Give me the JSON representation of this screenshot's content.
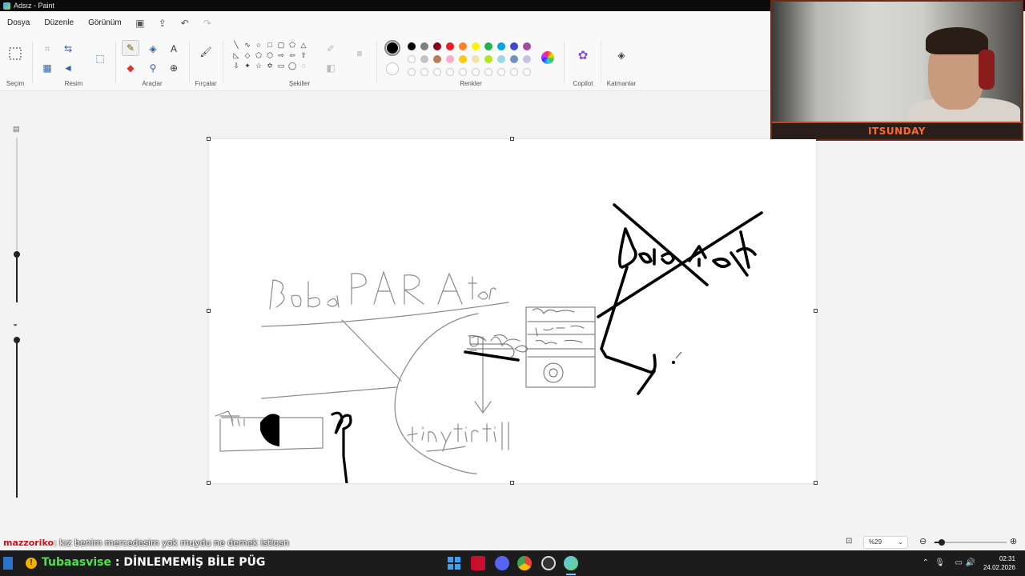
{
  "window": {
    "title": "Adsız - Paint"
  },
  "menu": {
    "items": [
      "Dosya",
      "Düzenle",
      "Görünüm"
    ]
  },
  "ribbon": {
    "groups": {
      "selection": "Seçim",
      "image": "Resim",
      "tools": "Araçlar",
      "brushes": "Fırçalar",
      "shapes": "Şekiller",
      "colors": "Renkler",
      "copilot": "Copilot",
      "layers": "Katmanlar"
    },
    "active_tool": "pencil",
    "primary_color": "#000000",
    "secondary_color": "#ffffff",
    "palette_row1": [
      "#000000",
      "#7f7f7f",
      "#880015",
      "#ed1c24",
      "#ff7f27",
      "#fff200",
      "#22b14c",
      "#00a2e8",
      "#3f48cc",
      "#a349a4"
    ],
    "palette_row2": [
      "#ffffff",
      "#c3c3c3",
      "#b97a57",
      "#ffaec9",
      "#ffc90e",
      "#efe4b0",
      "#b5e61d",
      "#99d9ea",
      "#7092be",
      "#c8bfe7"
    ],
    "palette_row3": [
      "",
      "",
      "",
      "",
      "",
      "",
      "",
      "",
      "",
      ""
    ]
  },
  "webcam": {
    "label": "ITSUNDAY"
  },
  "status": {
    "zoom": "%29",
    "zoom_level_fraction": 0.05
  },
  "chat": {
    "user": "mazzoriko",
    "message": ": kız benim mercedesim yok muydu ne demek istiosn"
  },
  "donation": {
    "name": "Tubaasvise",
    "message": " : DİNLEMEMİŞ BİLE PÜG"
  },
  "taskbar": {
    "time": "02:31",
    "date": "24.02.2026"
  }
}
